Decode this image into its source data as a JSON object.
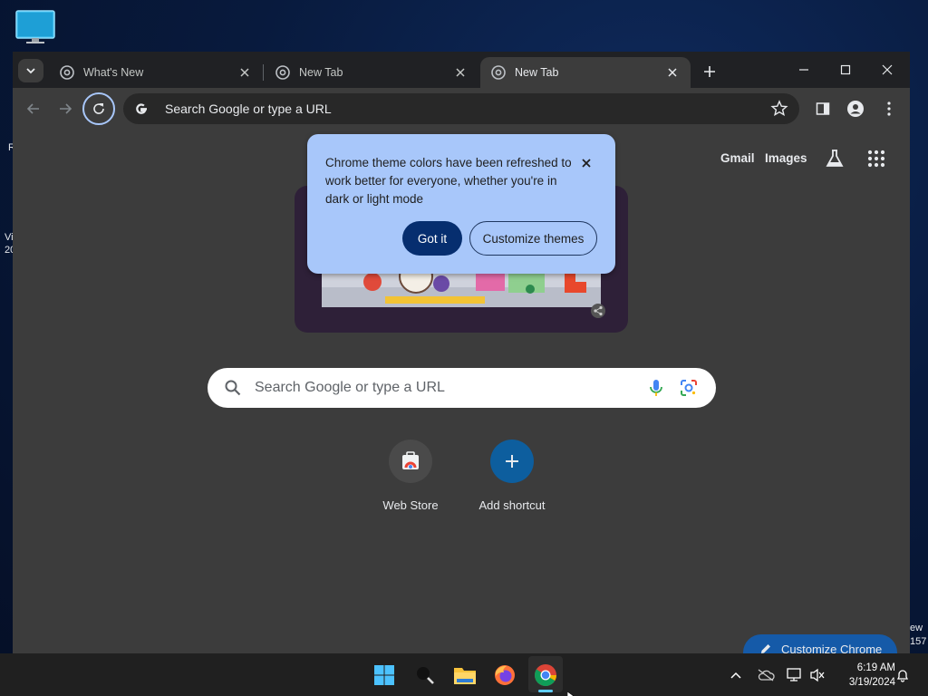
{
  "desktop": {
    "left_fragments": [
      "R",
      "Vi",
      "20"
    ],
    "right_fragments": [
      "ew",
      "157"
    ]
  },
  "browser": {
    "tabs": [
      {
        "title": "What's New",
        "active": false
      },
      {
        "title": "New Tab",
        "active": false
      },
      {
        "title": "New Tab",
        "active": true
      }
    ],
    "omnibox": {
      "placeholder": "Search Google or type a URL"
    },
    "ntp": {
      "links": {
        "gmail": "Gmail",
        "images": "Images"
      },
      "search_placeholder": "Search Google or type a URL",
      "shortcuts": [
        {
          "label": "Web Store",
          "icon": "web-store-icon"
        },
        {
          "label": "Add shortcut",
          "icon": "plus-icon"
        }
      ],
      "customize_label": "Customize Chrome"
    },
    "popup": {
      "message": "Chrome theme colors have been refreshed to work better for everyone, whether you're in dark or light mode",
      "primary_label": "Got it",
      "secondary_label": "Customize themes"
    }
  },
  "taskbar": {
    "time": "6:19 AM",
    "date": "3/19/2024"
  },
  "colors": {
    "popup_bg": "#a8c7fa",
    "primary_button": "#062e6f",
    "focus_ring": "#a8c7fa",
    "taskbar_indicator": "#60cdff"
  }
}
